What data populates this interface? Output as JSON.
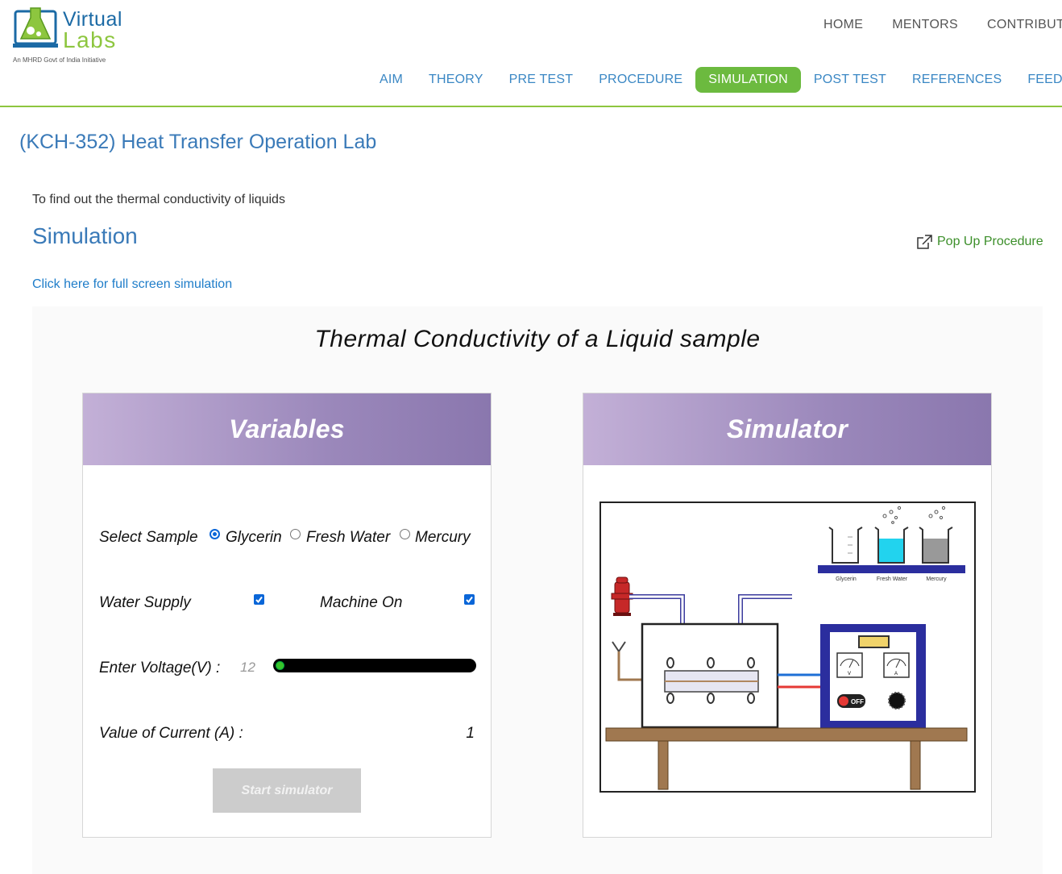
{
  "brand": {
    "word1": "Virtual",
    "word2": "Labs",
    "tagline": "An MHRD Govt of India Initiative"
  },
  "topnav": [
    "HOME",
    "MENTORS",
    "CONTRIBUT"
  ],
  "subnav": {
    "items": [
      "AIM",
      "THEORY",
      "PRE TEST",
      "PROCEDURE",
      "SIMULATION",
      "POST TEST",
      "REFERENCES",
      "FEEDB"
    ],
    "active": "SIMULATION"
  },
  "page": {
    "course_title": "(KCH-352) Heat Transfer Operation Lab",
    "aim": "To find out the thermal conductivity of liquids",
    "heading": "Simulation",
    "popup": "Pop Up Procedure",
    "fullscreen": "Click here for full screen simulation"
  },
  "sim": {
    "title": "Thermal Conductivity of a Liquid sample",
    "variables": {
      "heading": "Variables",
      "select_sample_label": "Select Sample",
      "samples": [
        "Glycerin",
        "Fresh Water",
        "Mercury"
      ],
      "selected_sample": "Glycerin",
      "water_supply_label": "Water Supply",
      "water_supply": true,
      "machine_on_label": "Machine On",
      "machine_on": true,
      "voltage_label": "Enter Voltage(V) :",
      "voltage_value": "12",
      "voltage_slider_fraction": 0.0,
      "current_label": "Value of Current (A) :",
      "current_value": "1",
      "start_button": "Start simulator"
    },
    "simulator": {
      "heading": "Simulator",
      "beaker_labels": [
        "Glycerin",
        "Fresh Water",
        "Mercury"
      ],
      "switch_label": "OFF",
      "voltmeter_label": "V",
      "ammeter_label": "A"
    },
    "colors": {
      "header_gradient_start": "#c3b0d7",
      "header_gradient_end": "#8a77ae",
      "accent_green": "#6cba3f",
      "link_blue": "#3a87c4",
      "water": "#22d3ee",
      "mercury": "#999999",
      "control_box": "#2b2e9e",
      "table_wood": "#a07850"
    }
  }
}
